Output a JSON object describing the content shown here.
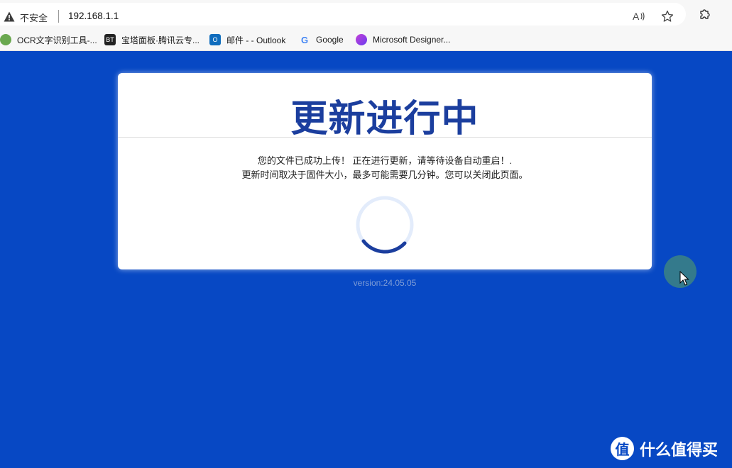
{
  "browser": {
    "security_label": "不安全",
    "url": "192.168.1.1",
    "toolbar_icons": [
      "read-aloud-icon",
      "favorite-star-icon",
      "extensions-icon"
    ]
  },
  "bookmarks": [
    {
      "label": "OCR文字识别工具-...",
      "icon": "ocr-frog-icon"
    },
    {
      "label": "宝塔面板·腾讯云专...",
      "icon": "bt-panel-icon",
      "icon_text": "BT"
    },
    {
      "label": "邮件 - - Outlook",
      "icon": "outlook-icon",
      "icon_text": "O"
    },
    {
      "label": "Google",
      "icon": "google-icon",
      "icon_text": "G"
    },
    {
      "label": "Microsoft Designer...",
      "icon": "designer-icon"
    }
  ],
  "page": {
    "title": "更新进行中",
    "message_line1": "您的文件已成功上传！ 正在进行更新，请等待设备自动重启！.",
    "message_line2": "更新时间取决于固件大小，最多可能需要几分钟。您可以关闭此页面。",
    "version": "version:24.05.05"
  },
  "watermark": {
    "badge": "值",
    "text": "什么值得买"
  },
  "colors": {
    "background": "#0748c4",
    "title": "#1b3e9e",
    "spinner_track": "#e3ecfb",
    "spinner_arc": "#1b3e9e"
  }
}
